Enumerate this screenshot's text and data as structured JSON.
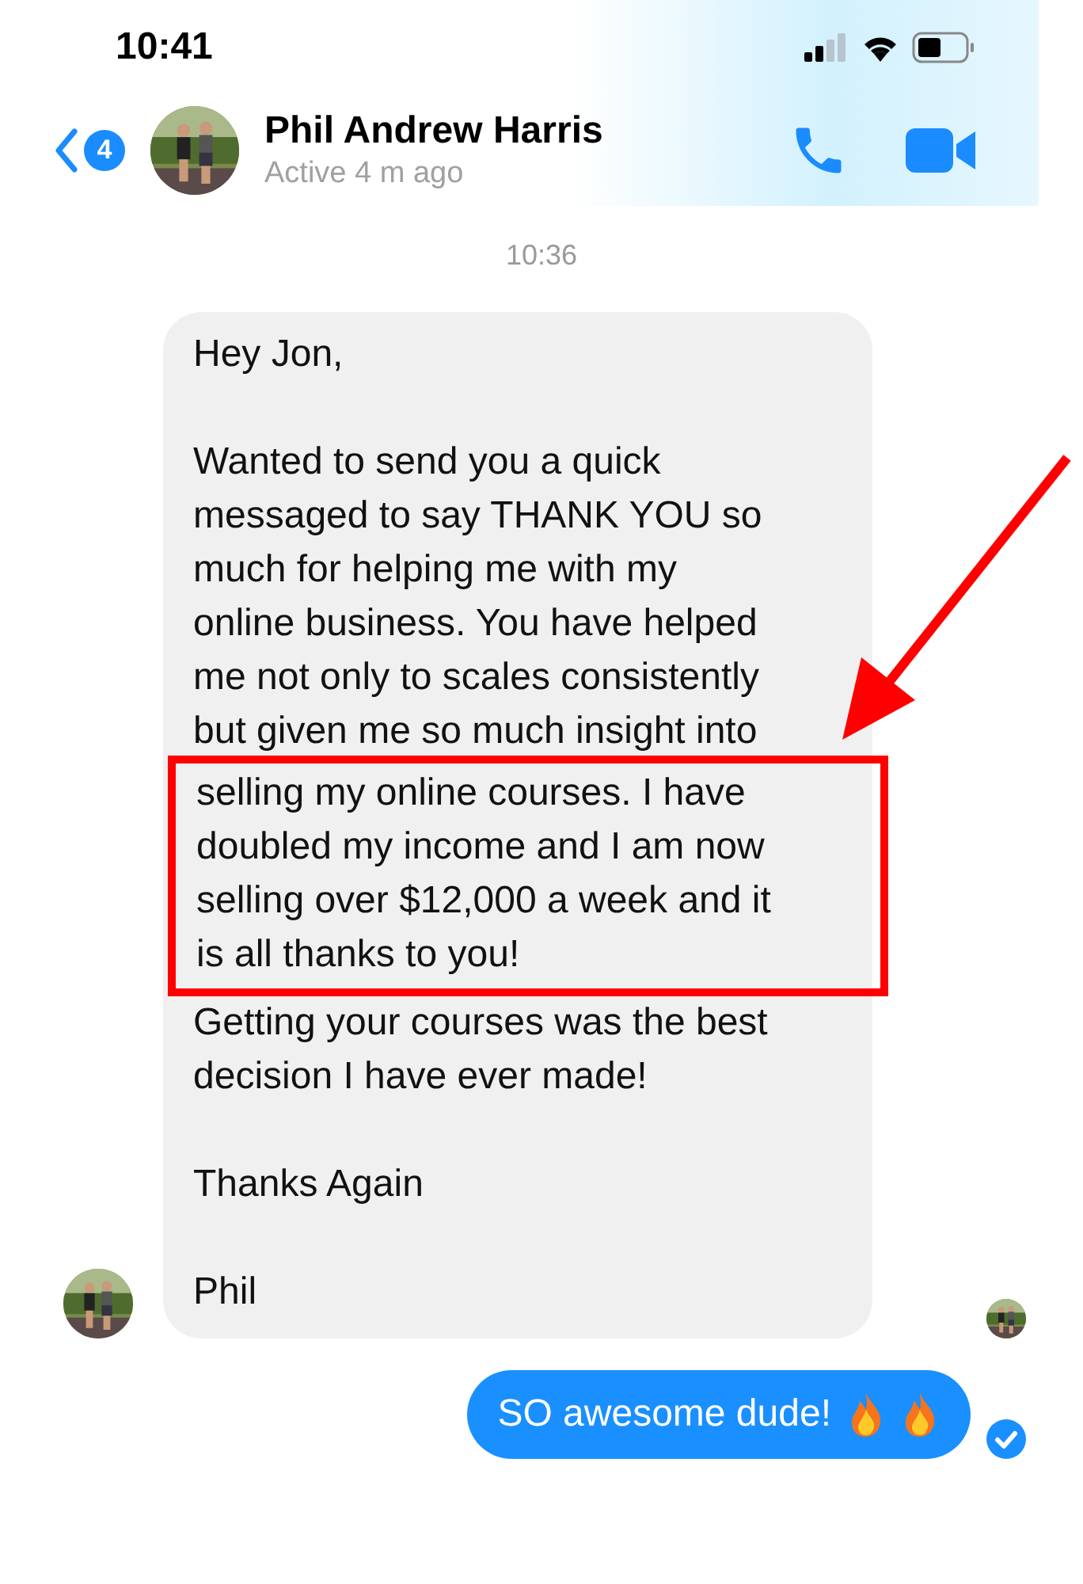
{
  "status_bar": {
    "time": "10:41"
  },
  "header": {
    "back_badge": "4",
    "name": "Phil Andrew Harris",
    "status": "Active 4 m ago"
  },
  "timestamp": "10:36",
  "incoming_message": {
    "blocks": [
      {
        "highlighted": false,
        "lines": [
          "Hey Jon,"
        ]
      },
      {
        "highlighted": false,
        "lines": [
          "Wanted to send you a quick",
          "messaged to say THANK YOU so",
          "much for helping me with my",
          "online business. You have helped",
          "me not only to scales consistently",
          "but given me so much insight into"
        ]
      },
      {
        "highlighted": true,
        "lines": [
          "selling my online courses. I have",
          "doubled my income and I am now",
          "selling over $12,000 a week and it",
          "is all thanks to you!"
        ]
      },
      {
        "highlighted": false,
        "lines": [
          "Getting your courses was the best",
          "decision I have ever made!"
        ]
      },
      {
        "highlighted": false,
        "lines": [
          "Thanks Again"
        ]
      },
      {
        "highlighted": false,
        "lines": [
          "Phil"
        ]
      }
    ]
  },
  "outgoing_message": {
    "text": "SO awesome dude!",
    "seen": true
  }
}
